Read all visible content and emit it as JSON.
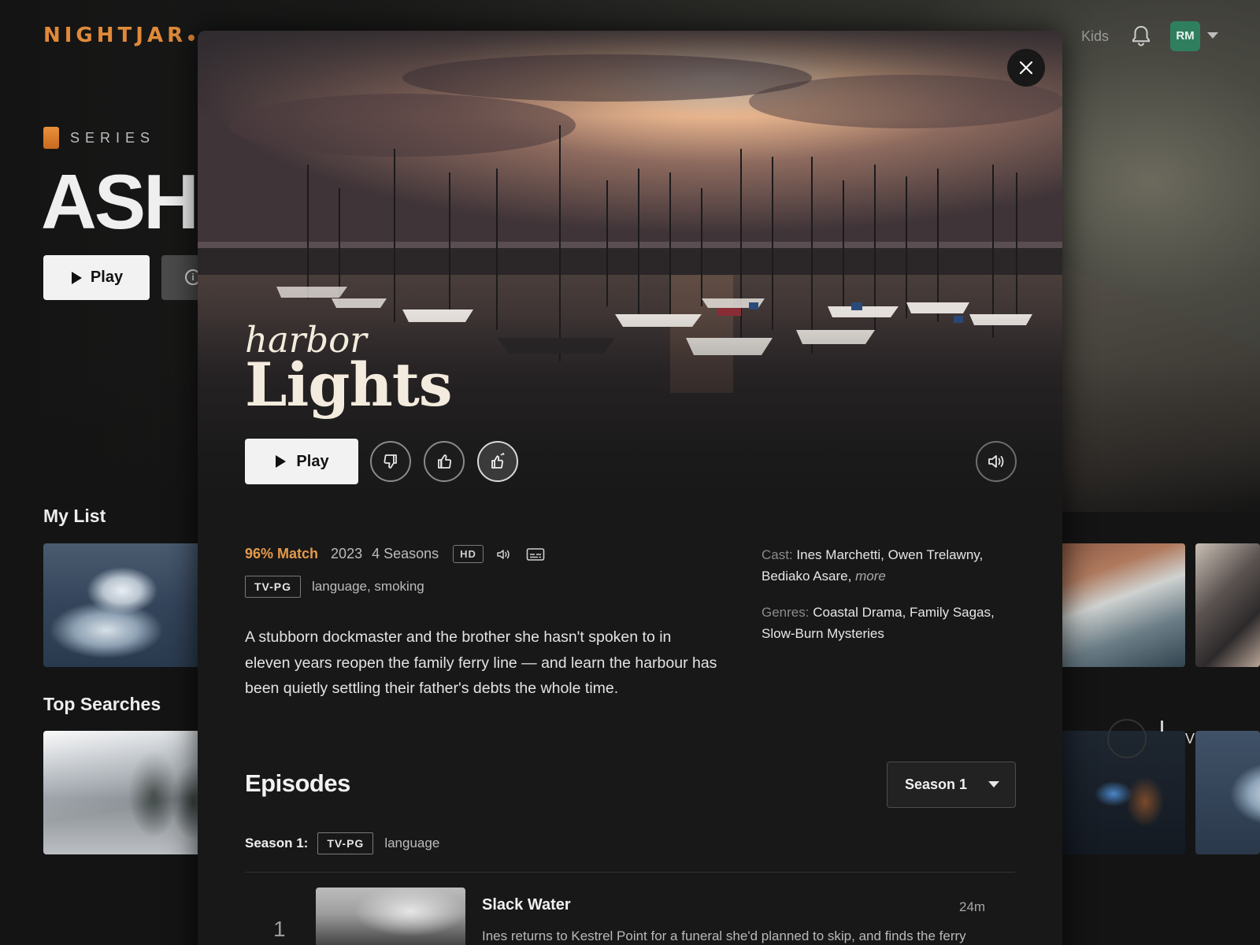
{
  "brand": {
    "name": "NIGHTJAR",
    "accent": "#e08a3a"
  },
  "nav": {
    "kids_label": "Kids",
    "avatar_initials": "RM",
    "avatar_color": "#2f7f5f"
  },
  "background": {
    "series_label": "SERIES",
    "title": "ASH",
    "play_label": "Play",
    "rows": [
      {
        "title": "My List"
      },
      {
        "title": "Top Searches"
      }
    ]
  },
  "modal": {
    "title_small": "harbor",
    "title_big": "Lights",
    "play_label": "Play",
    "match": "96% Match",
    "year": "2023",
    "seasons": "4 Seasons",
    "quality": "HD",
    "rating": "TV-PG",
    "advisories": "language, smoking",
    "synopsis": "A stubborn dockmaster and the brother she hasn't spoken to in eleven years reopen the family ferry line — and learn the harbour has been quietly settling their father's debts the whole time.",
    "cast_label": "Cast:",
    "cast": "Ines Marchetti, Owen Trelawny, Bediako Asare,",
    "cast_more": "more",
    "genres_label": "Genres:",
    "genres": "Coastal Drama, Family Sagas, Slow-Burn Mysteries",
    "episodes_heading": "Episodes",
    "season_selected": "Season 1",
    "season_meta_label": "Season 1:",
    "season_rating": "TV-PG",
    "season_advisories": "language",
    "episodes": [
      {
        "number": "1",
        "title": "Slack Water",
        "duration": "24m",
        "description": "Ines returns to Kestrel Point for a funeral she'd planned to skip, and finds the ferry"
      }
    ]
  },
  "icons": {
    "close": "close-icon",
    "dislike": "thumbs-down-icon",
    "like": "thumbs-up-icon",
    "love": "double-thumbs-up-icon",
    "volume": "volume-icon",
    "audio_description": "audio-description-icon",
    "subtitles": "subtitles-icon",
    "bell": "bell-icon"
  }
}
